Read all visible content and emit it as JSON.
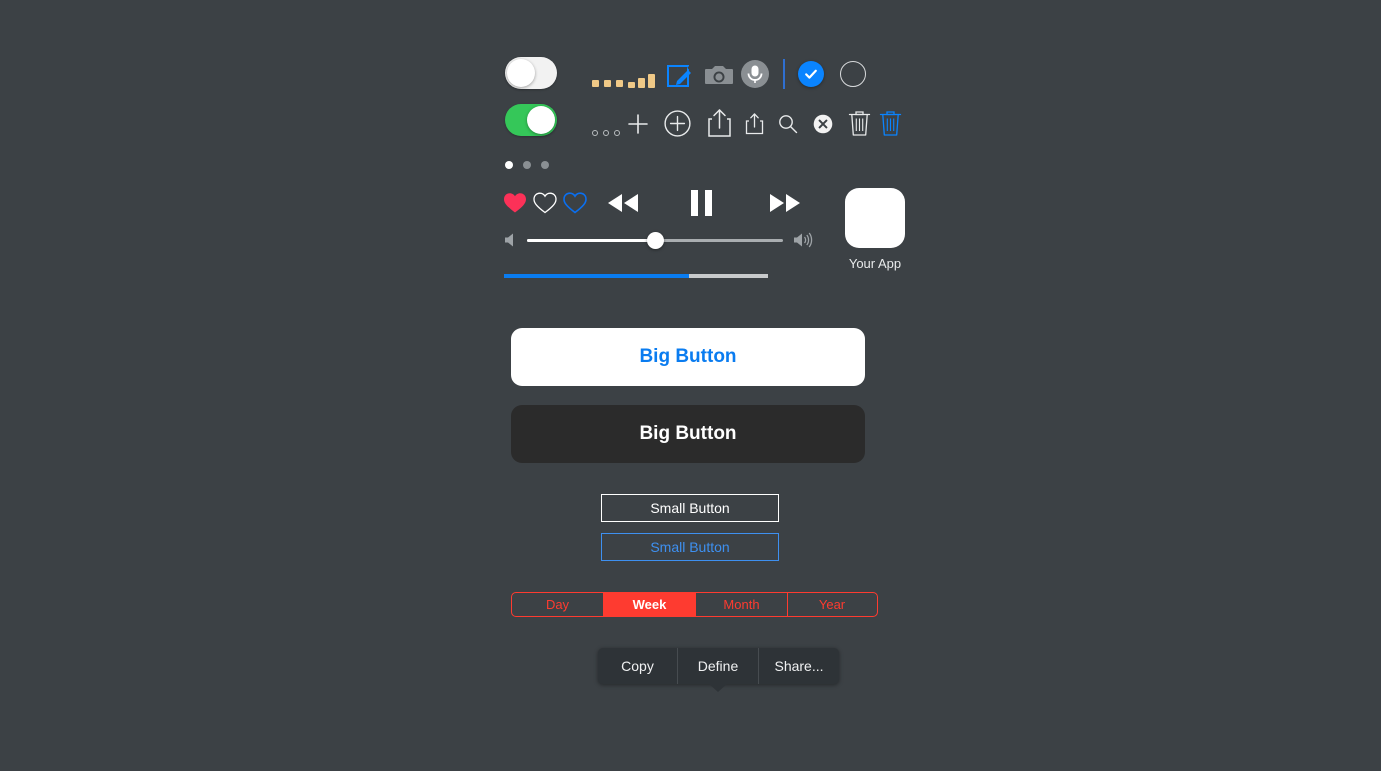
{
  "theme": {
    "background": "#3c4145",
    "accent_blue": "#0a84ff",
    "accent_green": "#35c759",
    "accent_red": "#fe3b30",
    "accent_tan": "#f0c987"
  },
  "row_switches": {
    "toggle_off": {
      "name": "toggle-off",
      "state": "off"
    },
    "toggle_on": {
      "name": "toggle-on",
      "state": "on"
    }
  },
  "row_one_icons": [
    {
      "name": "more-dots-icon",
      "label": "more"
    },
    {
      "name": "signal-bars-icon",
      "label": "signal"
    },
    {
      "name": "compose-icon",
      "label": "compose"
    },
    {
      "name": "camera-icon",
      "label": "camera"
    },
    {
      "name": "microphone-icon",
      "label": "microphone"
    },
    {
      "name": "divider-line",
      "label": "divider"
    },
    {
      "name": "checkmark-circle-icon",
      "label": "checked"
    },
    {
      "name": "empty-circle-icon",
      "label": "unchecked"
    }
  ],
  "row_two_icons": [
    {
      "name": "more-dots-small-icon",
      "label": "more"
    },
    {
      "name": "plus-icon",
      "label": "add"
    },
    {
      "name": "plus-circle-icon",
      "label": "add circled"
    },
    {
      "name": "share-icon",
      "label": "share"
    },
    {
      "name": "share-small-icon",
      "label": "share small"
    },
    {
      "name": "search-icon",
      "label": "search"
    },
    {
      "name": "close-circle-icon",
      "label": "close"
    },
    {
      "name": "trash-icon",
      "label": "delete"
    },
    {
      "name": "trash-blue-icon",
      "label": "delete blue"
    }
  ],
  "page_indicator": {
    "total": 3,
    "active_index": 0
  },
  "media": {
    "hearts": [
      {
        "name": "heart-filled-icon",
        "style": "filled-red"
      },
      {
        "name": "heart-outline-icon",
        "style": "outline-white"
      },
      {
        "name": "heart-outline-blue-icon",
        "style": "outline-blue"
      }
    ],
    "transport": [
      {
        "name": "rewind-button",
        "label": "rewind"
      },
      {
        "name": "pause-button",
        "label": "pause"
      },
      {
        "name": "fast-forward-button",
        "label": "fast forward"
      }
    ],
    "volume": {
      "name": "volume-slider",
      "value_percent": 50,
      "min_icon": "volume-low-icon",
      "max_icon": "volume-high-icon"
    },
    "progress": {
      "name": "progress-bar",
      "value_percent": 70
    }
  },
  "app": {
    "icon_name": "app-icon",
    "label": "Your App"
  },
  "buttons": {
    "big_light": "Big Button",
    "big_dark": "Big Button",
    "small_white": "Small Button",
    "small_blue": "Small Button"
  },
  "segmented_control": {
    "name": "period-segmented-control",
    "options": [
      "Day",
      "Week",
      "Month",
      "Year"
    ],
    "selected": "Week",
    "selected_index": 1
  },
  "context_menu": {
    "name": "text-context-menu",
    "items": [
      "Copy",
      "Define",
      "Share..."
    ]
  }
}
